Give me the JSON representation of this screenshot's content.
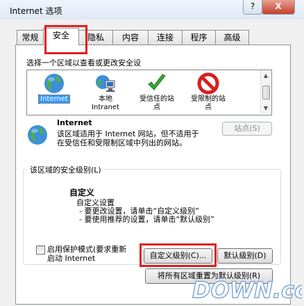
{
  "window": {
    "title": "Internet 选项",
    "help_label": "?",
    "close_label": "X"
  },
  "tabs": [
    "常规",
    "安全",
    "隐私",
    "内容",
    "连接",
    "程序",
    "高级"
  ],
  "security": {
    "select_zone_label": "选择一个区域以查看或更改安全设",
    "zones": [
      {
        "line1": "Internet",
        "line2": "",
        "icon": "globe-icon"
      },
      {
        "line1": "本地",
        "line2": "Intranet",
        "icon": "intranet-icon"
      },
      {
        "line1": "受信任的站",
        "line2": "点",
        "icon": "check-icon"
      },
      {
        "line1": "受限制的站",
        "line2": "点",
        "icon": "restricted-icon"
      }
    ],
    "zone_name": "Internet",
    "zone_description_1": "该区域适用于 Internet 网站，但不适用于",
    "zone_description_2": "在受信任和受限制区域中列出的网站。",
    "sites_button": "站点(S)",
    "level_group_title": "该区域的安全级别(L)",
    "level_title": "自定义",
    "level_desc_1": "自定义设置",
    "level_desc_2": "- 要更改设置，请单击“自定义级别”",
    "level_desc_3": "- 要使用推荐的设置，请单击“默认级别”",
    "protected_mode_label_1": "启用保护模式(要求重新",
    "protected_mode_label_2": "启动 Internet",
    "custom_level_button": "自定义级别(C)...",
    "default_level_button": "默认级别(D)",
    "reset_all_button": "将所有区域重置为默认级别(R)"
  },
  "watermark": {
    "text": "DOWN.cc"
  }
}
